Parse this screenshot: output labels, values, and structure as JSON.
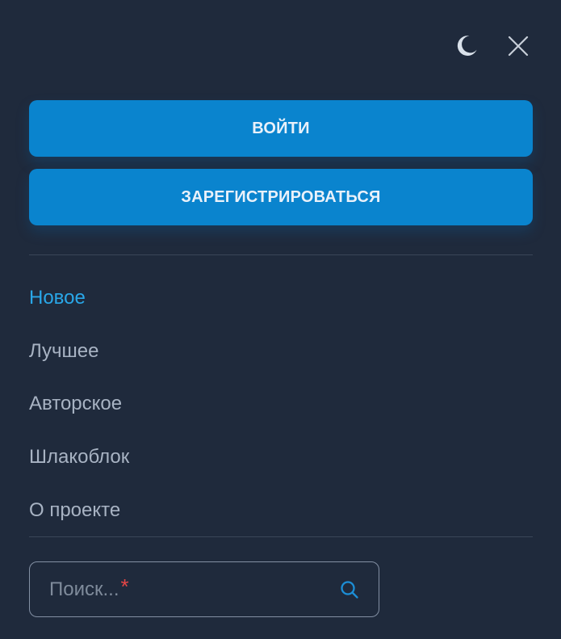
{
  "auth": {
    "login_label": "ВОЙТИ",
    "register_label": "ЗАРЕГИСТРИРОВАТЬСЯ"
  },
  "nav": {
    "items": [
      {
        "label": "Новое",
        "active": true
      },
      {
        "label": "Лучшее",
        "active": false
      },
      {
        "label": "Авторское",
        "active": false
      },
      {
        "label": "Шлакоблок",
        "active": false
      },
      {
        "label": "О проекте",
        "active": false
      }
    ]
  },
  "search": {
    "placeholder": "Поиск...",
    "required_mark": "*"
  },
  "icons": {
    "theme": "moon-icon",
    "close": "close-icon",
    "search": "search-icon"
  },
  "colors": {
    "background": "#1f2a3c",
    "accent": "#0a84ce",
    "active_link": "#29a7e8",
    "required": "#e54646"
  }
}
